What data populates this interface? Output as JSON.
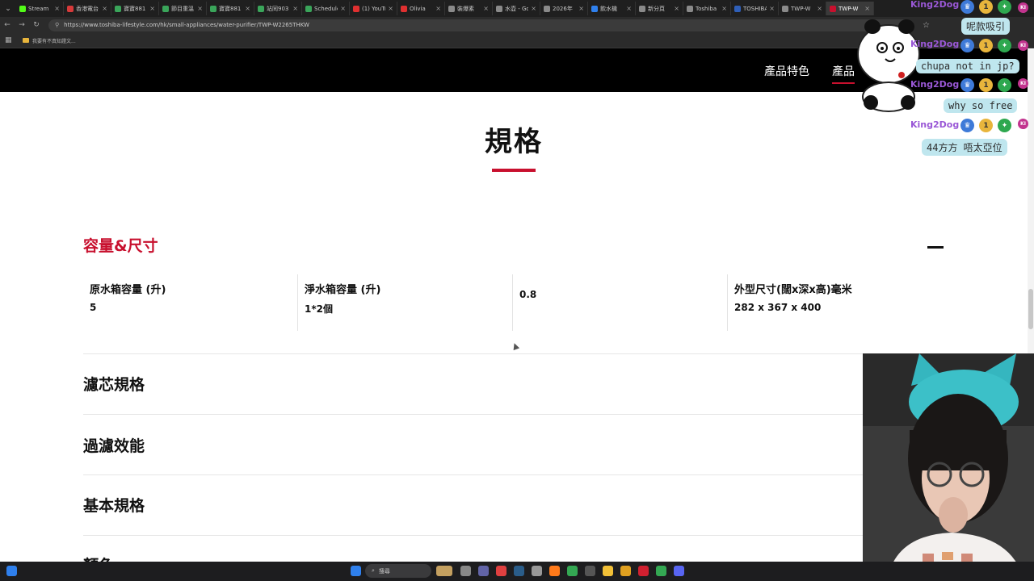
{
  "browser": {
    "tabs": [
      {
        "label": "Stream",
        "color": "#53fc18"
      },
      {
        "label": "香港電台",
        "color": "#d73a3a"
      },
      {
        "label": "寶寶881",
        "color": "#3aa55a"
      },
      {
        "label": "節目重溫",
        "color": "#3aa55a"
      },
      {
        "label": "寶寶881",
        "color": "#3aa55a"
      },
      {
        "label": "站同903",
        "color": "#3aa55a"
      },
      {
        "label": "Schedule",
        "color": "#3aa55a"
      },
      {
        "label": "(1) YouTu",
        "color": "#e03030"
      },
      {
        "label": "Olivia",
        "color": "#e03030"
      },
      {
        "label": "裝爆素",
        "color": "#8a8a8a"
      },
      {
        "label": "水壺 - Go",
        "color": "#8a8a8a"
      },
      {
        "label": "2026年",
        "color": "#8a8a8a"
      },
      {
        "label": "飲水機",
        "color": "#2f80ed"
      },
      {
        "label": "新分頁",
        "color": "#8a8a8a"
      },
      {
        "label": "Toshiba",
        "color": "#8a8a8a"
      },
      {
        "label": "TOSHIBA",
        "color": "#2f5fb8"
      },
      {
        "label": "TWP-W",
        "color": "#8a8a8a"
      },
      {
        "label": "TWP-W",
        "color": "#c8102e"
      }
    ],
    "url": "https://www.toshiba-lifestyle.com/hk/small-appliances/water-purifier/TWP-W2265THKW",
    "bookmark": "我要有不真知證文..."
  },
  "header": {
    "nav1": "產品特色",
    "nav2": "產品"
  },
  "spec": {
    "title": "規格",
    "open_section": "容量&尺寸",
    "cells": [
      {
        "label": "原水箱容量 (升)",
        "value": "5"
      },
      {
        "label": "淨水箱容量 (升)",
        "value": "1*2個"
      },
      {
        "label": "",
        "value": "0.8"
      },
      {
        "label": "外型尺寸(闊x深x高)毫米",
        "value": "282 x 367 x 400"
      }
    ],
    "collapsed_sections": [
      "濾芯規格",
      "過濾效能",
      "基本規格",
      "顏色"
    ]
  },
  "chat": {
    "messages": [
      {
        "user": "King2Dog",
        "text": "呢款吸引"
      },
      {
        "user": "King2Dog",
        "text": "chupa not in jp?"
      },
      {
        "user": "King2Dog",
        "text": "why so free"
      },
      {
        "user": "King2Dog",
        "text": "44方方 唔太亞位"
      }
    ],
    "badge_number": "1",
    "badge_ki": "KI"
  },
  "taskbar": {
    "search_label": "搜尋"
  },
  "colors": {
    "accent": "#c8102e",
    "header_bg": "#000000",
    "chat_bubble": "#bfe6ee",
    "chat_user": "#9a58d6"
  }
}
